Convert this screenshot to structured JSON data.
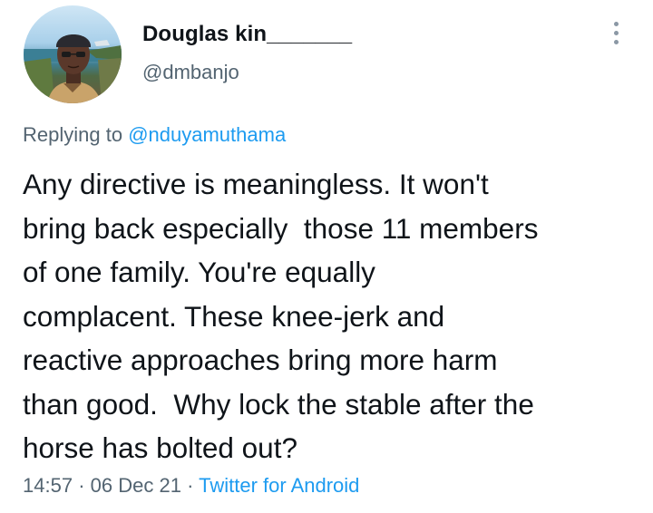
{
  "author": {
    "display_name": "Douglas kin_______",
    "handle": "@dmbanjo"
  },
  "reply_context": {
    "prefix": "Replying to",
    "mention": "@nduyamuthama"
  },
  "tweet": {
    "text": "Any directive is meaningless. It won't\nbring back especially  those 11 members\nof one family. You're equally\ncomplacent. These knee-jerk and\nreactive approaches bring more harm\nthan good.  Why lock the stable after the\nhorse has bolted out?"
  },
  "meta": {
    "time": "14:57",
    "separator": "·",
    "date": "06 Dec 21",
    "source": "Twitter for Android"
  },
  "icons": {
    "more": "more-vertical-icon"
  },
  "colors": {
    "link": "#1d9bf0",
    "secondary_text": "#536471",
    "primary_text": "#0f1419"
  }
}
